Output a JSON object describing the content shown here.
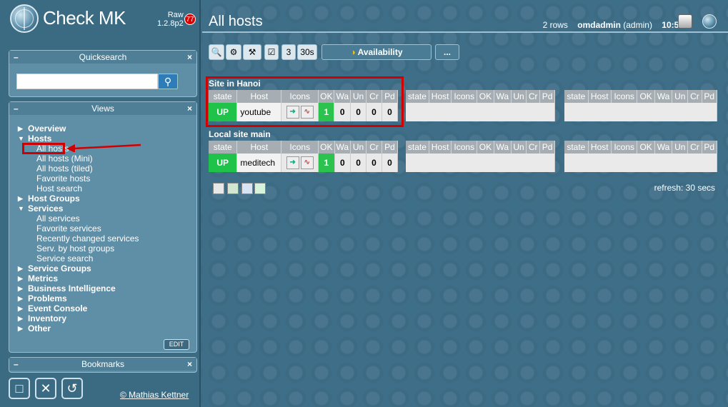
{
  "app": {
    "name": "Check MK",
    "edition": "Raw",
    "version": "1.2.8p2",
    "badge_count": "77"
  },
  "quicksearch": {
    "title": "Quicksearch",
    "value": ""
  },
  "views": {
    "title": "Views",
    "edit_label": "EDIT",
    "groups": [
      {
        "label": "Overview",
        "expanded": false,
        "items": []
      },
      {
        "label": "Hosts",
        "expanded": true,
        "items": [
          "All hosts",
          "All hosts (Mini)",
          "All hosts (tiled)",
          "Favorite hosts",
          "Host search"
        ]
      },
      {
        "label": "Host Groups",
        "expanded": false,
        "items": []
      },
      {
        "label": "Services",
        "expanded": true,
        "items": [
          "All services",
          "Favorite services",
          "Recently changed services",
          "Serv. by host groups",
          "Service search"
        ]
      },
      {
        "label": "Service Groups",
        "expanded": false,
        "items": []
      },
      {
        "label": "Metrics",
        "expanded": false,
        "items": []
      },
      {
        "label": "Business Intelligence",
        "expanded": false,
        "items": []
      },
      {
        "label": "Problems",
        "expanded": false,
        "items": []
      },
      {
        "label": "Event Console",
        "expanded": false,
        "items": []
      },
      {
        "label": "Inventory",
        "expanded": false,
        "items": []
      },
      {
        "label": "Other",
        "expanded": false,
        "items": []
      }
    ]
  },
  "bookmarks": {
    "title": "Bookmarks"
  },
  "footer": {
    "copyright": "© Mathias Kettner"
  },
  "header": {
    "title": "All hosts",
    "rows": "2 rows",
    "user": "omdadmin",
    "role": "(admin)",
    "time": "10:51"
  },
  "toolbar": {
    "refresh_count": "3",
    "refresh_interval": "30s",
    "availability_label": "Availability",
    "more_label": "..."
  },
  "columns": [
    "state",
    "Host",
    "Icons",
    "OK",
    "Wa",
    "Un",
    "Cr",
    "Pd"
  ],
  "sites": [
    {
      "name": "Site in Hanoi",
      "rows": [
        {
          "state": "UP",
          "host": "youtube",
          "ok": "1",
          "wa": "0",
          "un": "0",
          "cr": "0",
          "pd": "0"
        }
      ]
    },
    {
      "name": "Local site main",
      "rows": [
        {
          "state": "UP",
          "host": "meditech",
          "ok": "1",
          "wa": "0",
          "un": "0",
          "cr": "0",
          "pd": "0"
        }
      ]
    }
  ],
  "refresh_text": "refresh: 30 secs",
  "colors": {
    "up": "#1fc34a",
    "highlight": "#d10000",
    "background": "#3f6f88"
  }
}
